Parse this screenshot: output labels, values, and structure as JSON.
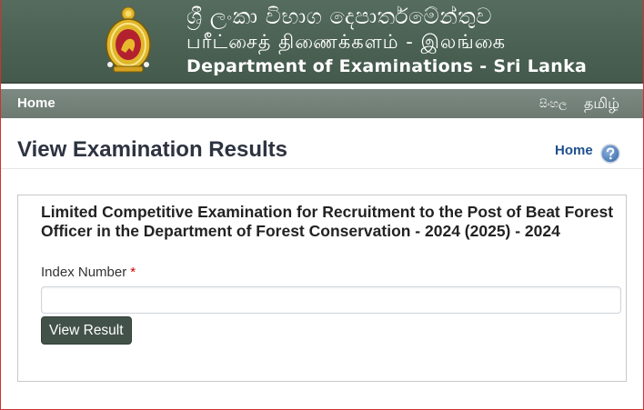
{
  "header": {
    "title_sinhala": "ශ්‍රී ලංකා විභාග දෙපාර්තමේන්තුව",
    "title_tamil": "பரீட்சைத் திணைக்களம் - இலங்கை",
    "title_english": "Department of Examinations - Sri Lanka",
    "emblem_icon": "sri-lanka-emblem-icon"
  },
  "nav": {
    "home_label": "Home",
    "lang_sinhala": "සිංහල",
    "lang_tamil": "தமிழ்"
  },
  "page": {
    "title": "View Examination Results",
    "home_link": "Home",
    "help_icon": "help-question-icon"
  },
  "form": {
    "exam_title": "Limited Competitive Examination for Recruitment to the Post of Beat Forest Officer in the Department of Forest Conservation - 2024 (2025) - 2024",
    "index_label": "Index Number",
    "required_mark": "*",
    "index_value": "",
    "submit_label": "View Result"
  },
  "colors": {
    "banner": "#4a6153",
    "navbar": "#748279",
    "button": "#425249",
    "link": "#1f4f8f",
    "required": "#cc0000"
  }
}
